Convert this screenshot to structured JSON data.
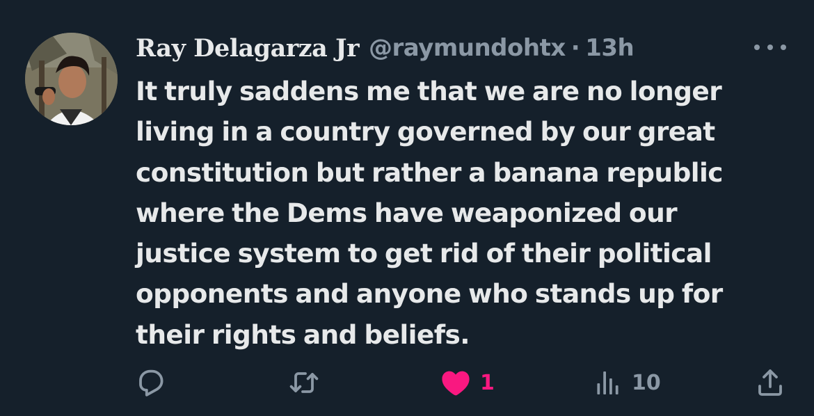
{
  "tweet": {
    "author_name": "Ray Delagarza Jr",
    "handle": "@raymundohtx",
    "separator": "·",
    "time": "13h",
    "text_lines": [
      "It truly saddens me that we are no longer",
      "living in a country governed by our great",
      "constitution but rather a banana republic",
      "where the Dems have weaponized our",
      "justice system to get rid of their political",
      "opponents and anyone who stands up for",
      "their rights and beliefs."
    ]
  },
  "actions": {
    "reply_icon": "reply-icon",
    "retweet_icon": "retweet-icon",
    "like_icon": "heart-icon",
    "like_count": "1",
    "views_icon": "views-icon",
    "views_count": "10",
    "share_icon": "share-icon"
  },
  "colors": {
    "background": "#15202b",
    "text": "#e7e9ea",
    "muted": "#8b98a5",
    "like": "#f91880"
  }
}
